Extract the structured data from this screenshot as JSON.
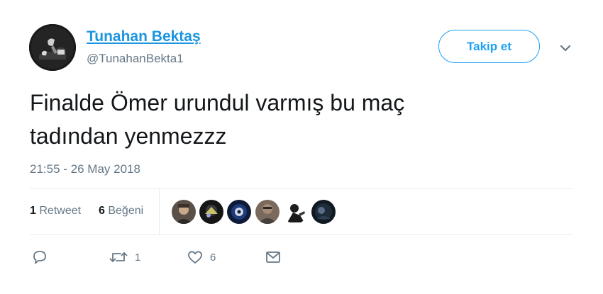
{
  "user": {
    "display_name": "Tunahan Bektaş",
    "handle": "@TunahanBekta1",
    "avatar_icon": "profile-photo"
  },
  "header": {
    "follow_label": "Takip et",
    "more_icon": "chevron-down-icon"
  },
  "tweet": {
    "text_line1": "Finalde Ömer urundul varmış bu maç",
    "text_line2": "tadından yenmezzz",
    "timestamp": "21:55 - 26 May 2018"
  },
  "stats": {
    "retweet_count": "1",
    "retweet_label": "Retweet",
    "like_count": "6",
    "like_label": "Beğeni",
    "likers_count": 6
  },
  "actions": {
    "reply_icon": "reply-icon",
    "retweet_icon": "retweet-icon",
    "retweet_count": "1",
    "like_icon": "heart-icon",
    "like_count": "6",
    "dm_icon": "envelope-icon"
  },
  "colors": {
    "accent": "#1da1f2",
    "link": "#1b95e0",
    "muted": "#657786",
    "text": "#14171a",
    "divider": "#e6ecf0"
  }
}
